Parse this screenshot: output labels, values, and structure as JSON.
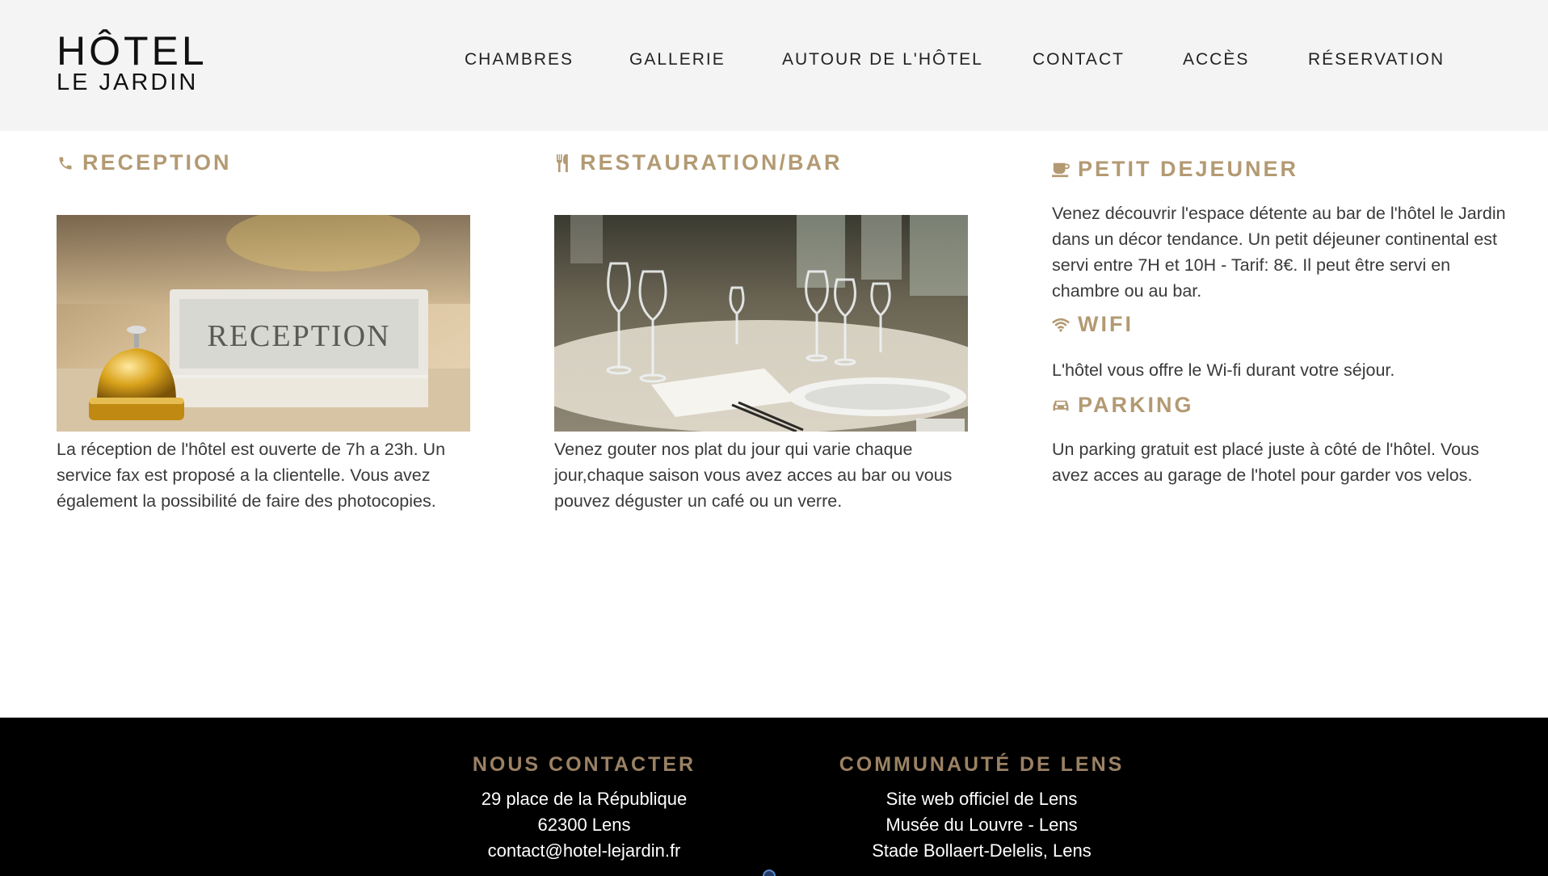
{
  "header": {
    "logo_line1": "HÔTEL",
    "logo_line2": "LE JARDIN",
    "nav": [
      {
        "label": "CHAMBRES"
      },
      {
        "label": "GALLERIE"
      },
      {
        "label": "AUTOUR DE L'HÔTEL"
      },
      {
        "label": "CONTACT"
      },
      {
        "label": "ACCÈS"
      },
      {
        "label": "RÉSERVATION"
      }
    ]
  },
  "sections": {
    "reception": {
      "title": "RECEPTION",
      "icon": "phone-icon",
      "image_sign_text": "RECEPTION",
      "text": "La réception de l'hôtel est ouverte de 7h a 23h. Un service fax est proposé a la clientelle. Vous avez également la possibilité de faire des photocopies."
    },
    "restaurant": {
      "title": "RESTAURATION/BAR",
      "icon": "utensils-icon",
      "text": "Venez gouter nos plat du jour qui varie chaque jour,chaque saison vous avez acces au bar ou vous pouvez déguster un café ou un verre."
    },
    "breakfast": {
      "title": "PETIT DEJEUNER",
      "icon": "coffee-cup-icon",
      "text": "Venez découvrir l'espace détente au bar de l'hôtel le Jardin dans un décor tendance. Un petit déjeuner continental est servi entre 7H et 10H - Tarif: 8€. Il peut être servi en chambre ou au bar."
    },
    "wifi": {
      "title": "WIFI",
      "icon": "wifi-icon",
      "text": "L'hôtel vous offre le Wi-fi durant votre séjour."
    },
    "parking": {
      "title": "PARKING",
      "icon": "car-icon",
      "text": "Un parking gratuit est placé juste à côté de l'hôtel. Vous avez acces au garage de l'hotel pour garder vos velos."
    }
  },
  "footer": {
    "contact": {
      "title": "NOUS CONTACTER",
      "lines": [
        "29 place de la République",
        "62300 Lens",
        "contact@hotel-lejardin.fr"
      ]
    },
    "community": {
      "title": "COMMUNAUTÉ DE LENS",
      "lines": [
        "Site web officiel de Lens",
        "Musée du Louvre - Lens",
        "Stade Bollaert-Delelis, Lens"
      ]
    }
  },
  "colors": {
    "accent": "#b39a73",
    "footer_accent": "#9b8264",
    "header_bg": "#f4f4f4",
    "footer_bg": "#000000"
  }
}
